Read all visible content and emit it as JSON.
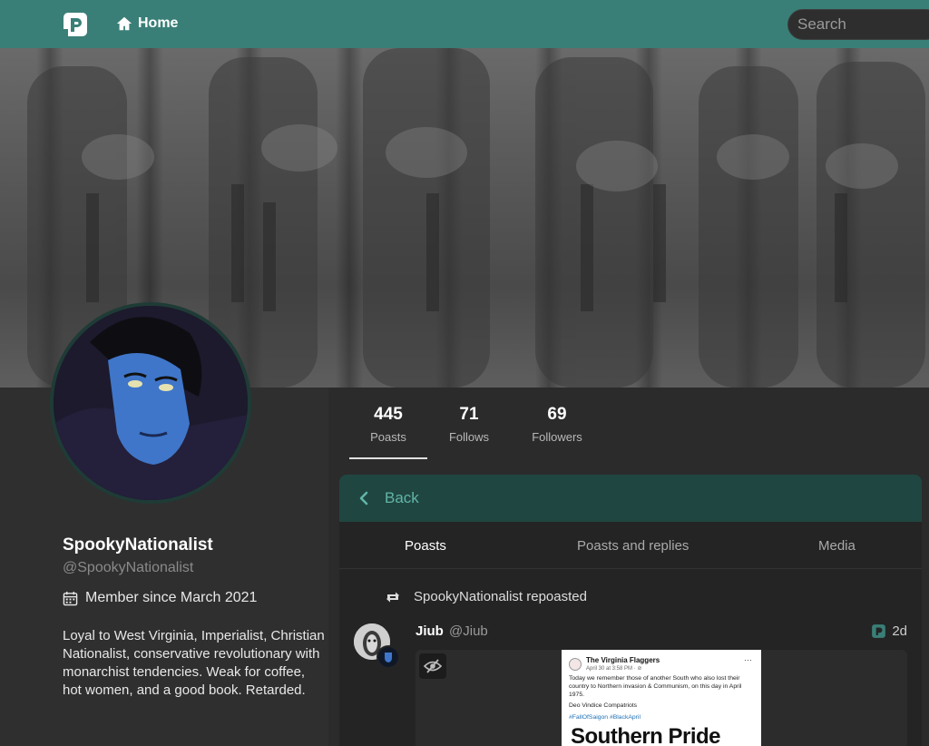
{
  "nav": {
    "home_label": "Home",
    "search_placeholder": "Search"
  },
  "colors": {
    "brand": "#3a7f77",
    "accent_text": "#62b5a8",
    "back_bar": "#1f4640"
  },
  "profile": {
    "display_name": "SpookyNationalist",
    "handle": "@SpookyNationalist",
    "member_since": "Member since March 2021",
    "bio": "Loyal to West Virginia, Imperialist, Christian Nationalist, conservative revolutionary with monarchist tendencies. Weak for coffee, hot women, and a good book. Retarded."
  },
  "stats": [
    {
      "value": "445",
      "label": "Poasts"
    },
    {
      "value": "71",
      "label": "Follows"
    },
    {
      "value": "69",
      "label": "Followers"
    }
  ],
  "feed": {
    "back_label": "Back",
    "tabs": [
      "Poasts",
      "Poasts and replies",
      "Media"
    ],
    "active_tab": "Poasts"
  },
  "post": {
    "repost_text": "SpookyNationalist repoasted",
    "author_name": "Jiub",
    "author_handle": "@Jiub",
    "time": "2d",
    "media": {
      "page_title": "The Virginia Flaggers",
      "page_date": "April 30 at 3:58 PM · ⊘",
      "body": "Today we remember those of another South who also lost their country to Northern invasion & Communism, on this day in April 1975.",
      "signoff": "Deo Vindice Compatriots",
      "tags": "#FallOfSaigon #BlackApril",
      "headline": "Southern Pride"
    }
  },
  "icons": {
    "logo": "poa-logo-icon",
    "home": "home-icon",
    "calendar": "calendar-icon",
    "back": "chevron-left-icon",
    "repost": "repost-icon",
    "hide_media": "eye-slash-icon",
    "instance": "poa-instance-icon"
  }
}
